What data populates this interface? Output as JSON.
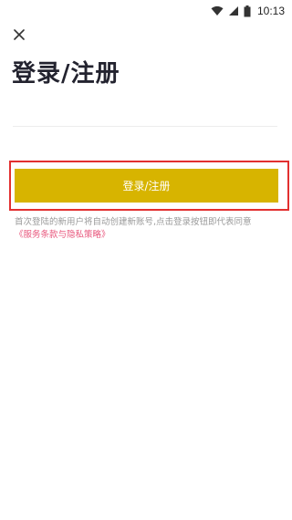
{
  "status_bar": {
    "time": "10:13",
    "icons": [
      "wifi-icon",
      "signal-icon",
      "battery-icon"
    ]
  },
  "header": {
    "close_icon": "close-icon",
    "title": "登录/注册"
  },
  "login": {
    "button_label": "登录/注册",
    "button_color": "#d7b400",
    "highlight_color": "#e23030"
  },
  "notice": {
    "text": "首次登陆的新用户将自动创建新账号,点击登录按钮即代表同意",
    "terms_link": "《服务条款与隐私策略》",
    "link_color": "#e8567c"
  }
}
